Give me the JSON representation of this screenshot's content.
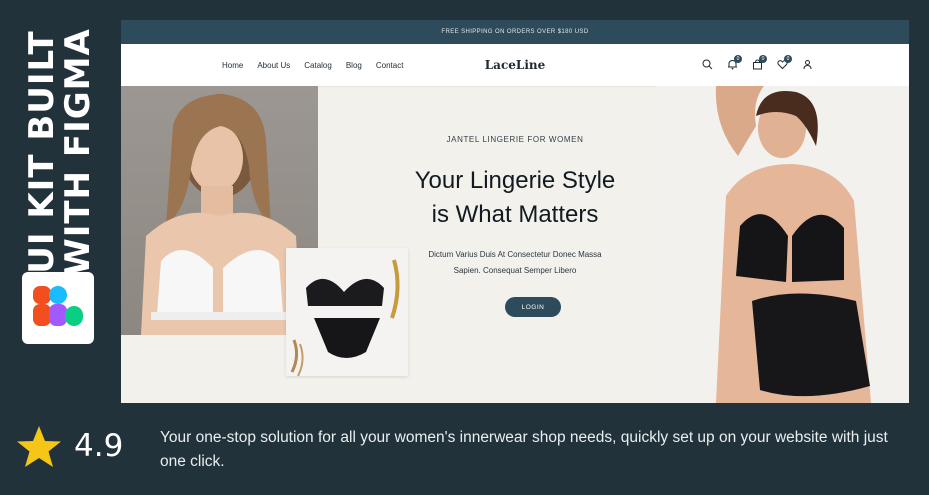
{
  "promo": {
    "title_line1": "UI KIT BUILT",
    "title_line2": "WITH FIGMA",
    "figma_icon": "figma-logo-icon",
    "rating": "4.9",
    "star_icon": "star-icon",
    "description": "Your one-stop solution for all your women's innerwear shop needs, quickly set up on your website with just one click."
  },
  "site": {
    "topbar_text": "FREE SHIPPING ON ORDERS OVER $180 USD",
    "logo": "LaceLine",
    "nav": [
      "Home",
      "About Us",
      "Catalog",
      "Blog",
      "Contact"
    ],
    "icons": {
      "search": "search-icon",
      "notifications": {
        "name": "bell-icon",
        "count": "0"
      },
      "cart": {
        "name": "bag-icon",
        "count": "0"
      },
      "wishlist": {
        "name": "heart-icon",
        "count": "0"
      },
      "account": "user-icon"
    },
    "hero": {
      "eyebrow": "JANTEL LINGERIE FOR WOMEN",
      "headline_line1": "Your Lingerie Style",
      "headline_line2": "is What Matters",
      "sub_line1": "Dictum Varius Duis At Consectetur Donec Massa",
      "sub_line2": "Sapien. Consequat Semper Libero",
      "cta": "LOGIN"
    }
  },
  "colors": {
    "background": "#22323a",
    "brand": "#2d4b5a",
    "hero_bg": "#f3f1ec",
    "star": "#f5c518"
  }
}
